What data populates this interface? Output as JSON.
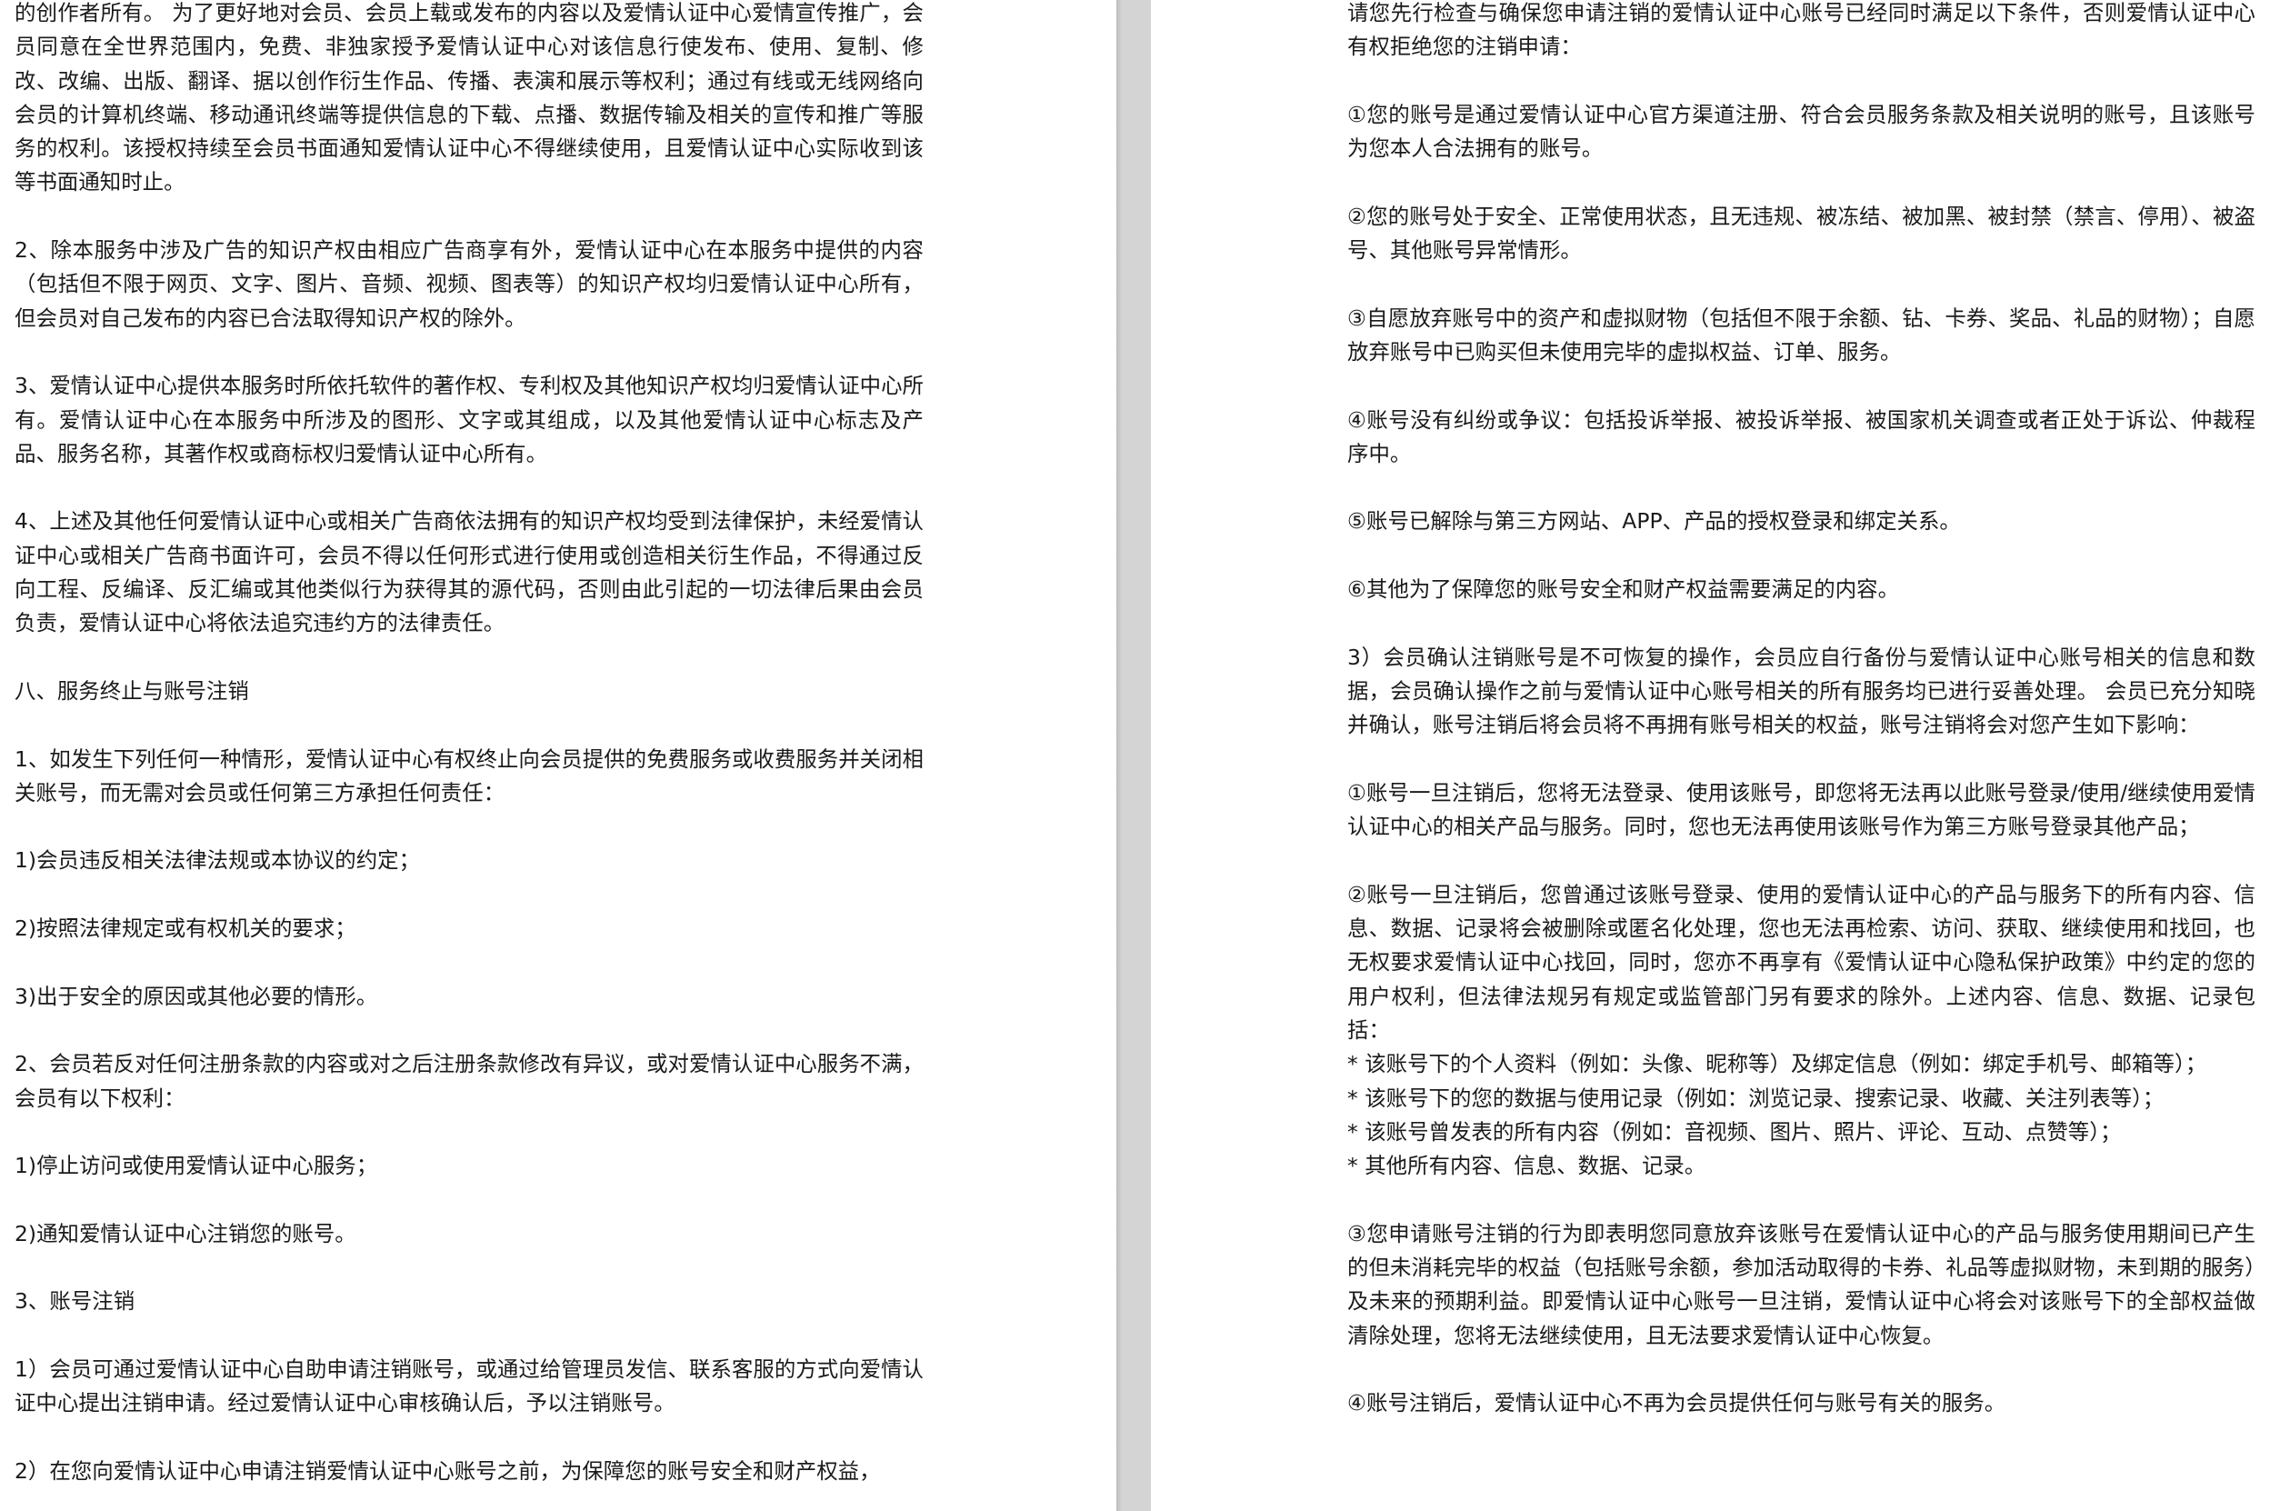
{
  "left_page": {
    "paragraphs": [
      "的创作者所有。  为了更好地对会员、会员上载或发布的内容以及爱情认证中心爱情宣传推广，会员同意在全世界范围内，免费、非独家授予爱情认证中心对该信息行使发布、使用、复制、修改、改编、出版、翻译、据以创作衍生作品、传播、表演和展示等权利；通过有线或无线网络向会员的计算机终端、移动通讯终端等提供信息的下载、点播、数据传输及相关的宣传和推广等服务的权利。该授权持续至会员书面通知爱情认证中心不得继续使用，且爱情认证中心实际收到该等书面通知时止。",
      "2、除本服务中涉及广告的知识产权由相应广告商享有外，爱情认证中心在本服务中提供的内容（包括但不限于网页、文字、图片、音频、视频、图表等）的知识产权均归爱情认证中心所有，但会员对自己发布的内容已合法取得知识产权的除外。",
      "3、爱情认证中心提供本服务时所依托软件的著作权、专利权及其他知识产权均归爱情认证中心所有。爱情认证中心在本服务中所涉及的图形、文字或其组成，以及其他爱情认证中心标志及产品、服务名称，其著作权或商标权归爱情认证中心所有。",
      "4、上述及其他任何爱情认证中心或相关广告商依法拥有的知识产权均受到法律保护，未经爱情认证中心或相关广告商书面许可，会员不得以任何形式进行使用或创造相关衍生作品，不得通过反向工程、反编译、反汇编或其他类似行为获得其的源代码，否则由此引起的一切法律后果由会员负责，爱情认证中心将依法追究违约方的法律责任。",
      "八、服务终止与账号注销",
      "1、如发生下列任何一种情形，爱情认证中心有权终止向会员提供的免费服务或收费服务并关闭相关账号，而无需对会员或任何第三方承担任何责任：",
      "1)会员违反相关法律法规或本协议的约定；",
      "2)按照法律规定或有权机关的要求；",
      "3)出于安全的原因或其他必要的情形。",
      "2、会员若反对任何注册条款的内容或对之后注册条款修改有异议，或对爱情认证中心服务不满，会员有以下权利：",
      "1)停止访问或使用爱情认证中心服务；",
      "2)通知爱情认证中心注销您的账号。",
      "3、账号注销",
      "1）会员可通过爱情认证中心自助申请注销账号，或通过给管理员发信、联系客服的方式向爱情认证中心提出注销申请。经过爱情认证中心审核确认后，予以注销账号。",
      "2）在您向爱情认证中心申请注销爱情认证中心账号之前，为保障您的账号安全和财产权益，"
    ]
  },
  "right_page": {
    "paragraphs": [
      "请您先行检查与确保您申请注销的爱情认证中心账号已经同时满足以下条件，否则爱情认证中心有权拒绝您的注销申请：",
      "①您的账号是通过爱情认证中心官方渠道注册、符合会员服务条款及相关说明的账号，且该账号为您本人合法拥有的账号。",
      "②您的账号处于安全、正常使用状态，且无违规、被冻结、被加黑、被封禁（禁言、停用）、被盗号、其他账号异常情形。",
      "③自愿放弃账号中的资产和虚拟财物（包括但不限于余额、钻、卡券、奖品、礼品的财物）；自愿放弃账号中已购买但未使用完毕的虚拟权益、订单、服务。",
      "④账号没有纠纷或争议：包括投诉举报、被投诉举报、被国家机关调查或者正处于诉讼、仲裁程序中。",
      "⑤账号已解除与第三方网站、APP、产品的授权登录和绑定关系。",
      "⑥其他为了保障您的账号安全和财产权益需要满足的内容。",
      "3）会员确认注销账号是不可恢复的操作，会员应自行备份与爱情认证中心账号相关的信息和数据，会员确认操作之前与爱情认证中心账号相关的所有服务均已进行妥善处理。  会员已充分知晓并确认，账号注销后将会员将不再拥有账号相关的权益，账号注销将会对您产生如下影响：",
      "①账号一旦注销后，您将无法登录、使用该账号，即您将无法再以此账号登录/使用/继续使用爱情认证中心的相关产品与服务。同时，您也无法再使用该账号作为第三方账号登录其他产品；",
      "②账号一旦注销后，您曾通过该账号登录、使用的爱情认证中心的产品与服务下的所有内容、信息、数据、记录将会被删除或匿名化处理，您也无法再检索、访问、获取、继续使用和找回，也无权要求爱情认证中心找回，同时，您亦不再享有《爱情认证中心隐私保护政策》中约定的您的用户权利，但法律法规另有规定或监管部门另有要求的除外。上述内容、信息、数据、记录包括：",
      "*  该账号下的个人资料（例如：头像、昵称等）及绑定信息（例如：绑定手机号、邮箱等）；",
      "*  该账号下的您的数据与使用记录（例如：浏览记录、搜索记录、收藏、关注列表等）；",
      "*  该账号曾发表的所有内容（例如：音视频、图片、照片、评论、互动、点赞等）；",
      "*  其他所有内容、信息、数据、记录。",
      "③您申请账号注销的行为即表明您同意放弃该账号在爱情认证中心的产品与服务使用期间已产生的但未消耗完毕的权益（包括账号余额，参加活动取得的卡券、礼品等虚拟财物，未到期的服务）及未来的预期利益。即爱情认证中心账号一旦注销，爱情认证中心将会对该账号下的全部权益做清除处理，您将无法继续使用，且无法要求爱情认证中心恢复。",
      "④账号注销后，爱情认证中心不再为会员提供任何与账号有关的服务。"
    ]
  }
}
